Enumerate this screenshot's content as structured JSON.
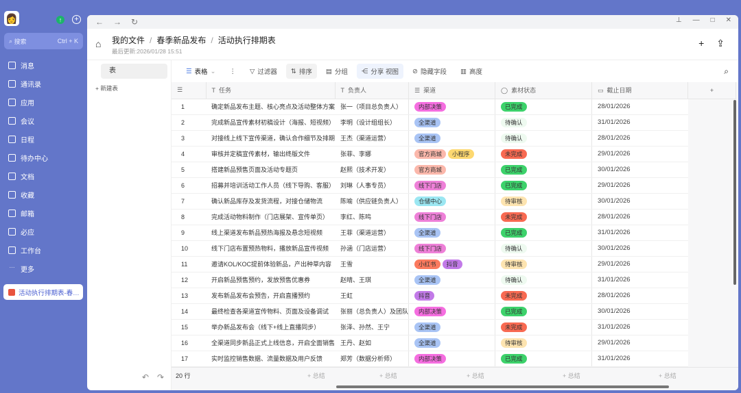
{
  "sidebar": {
    "search_placeholder": "搜索",
    "search_shortcut": "Ctrl + K",
    "items": [
      {
        "label": "消息",
        "icon": "message-icon"
      },
      {
        "label": "通讯录",
        "icon": "contacts-icon"
      },
      {
        "label": "应用",
        "icon": "apps-icon"
      },
      {
        "label": "会议",
        "icon": "meeting-icon"
      },
      {
        "label": "日程",
        "icon": "calendar-icon"
      },
      {
        "label": "待办中心",
        "icon": "todo-icon"
      },
      {
        "label": "文档",
        "icon": "docs-icon"
      },
      {
        "label": "收藏",
        "icon": "favorites-icon"
      },
      {
        "label": "邮箱",
        "icon": "mail-icon"
      },
      {
        "label": "必应",
        "icon": "bolt-icon"
      },
      {
        "label": "工作台",
        "icon": "workbench-icon"
      },
      {
        "label": "更多",
        "icon": "more-icon"
      }
    ],
    "recent": "活动执行排期表-春季新品发布"
  },
  "header": {
    "breadcrumb": [
      "我的文件",
      "春季新品发布",
      "活动执行排期表"
    ],
    "last_updated": "最后更新:2026/01/28 15:51"
  },
  "left_panel": {
    "table_name": "表",
    "new_table": "+ 新建表"
  },
  "toolbar": {
    "view": "表格",
    "filter": "过滤器",
    "sort": "排序",
    "group": "分组",
    "share": "分享 视图",
    "hide": "隐藏字段",
    "height": "高度"
  },
  "columns": [
    "任务",
    "负责人",
    "渠道",
    "素材状态",
    "截止日期"
  ],
  "tag_colors": {
    "内部决策": "#f56ee0",
    "全渠道": "#a9c4f5",
    "官方商城": "#fbb8ab",
    "小程序": "#fdd870",
    "线下门店": "#ee80d8",
    "仓储中心": "#9be7f2",
    "小红书": "#fb7a5e",
    "抖音": "#c27ae8",
    "已完成": "#3dd26b",
    "待确认": "#eefaf0",
    "未完成": "#f86a52",
    "待审核": "#fde4b0"
  },
  "rows": [
    {
      "n": "1",
      "task": "确定新品发布主题、核心亮点及活动整体方案",
      "owner": "张一（项目总负责人）",
      "channels": [
        "内部决策"
      ],
      "status": "已完成",
      "date": "28/01/2026"
    },
    {
      "n": "2",
      "task": "完成新品宣传素材初稿设计（海报、短视频）",
      "owner": "李明（设计组组长）",
      "channels": [
        "全渠道"
      ],
      "status": "待确认",
      "date": "31/01/2026"
    },
    {
      "n": "3",
      "task": "对接线上线下宣传渠道，确认合作细节及排期",
      "owner": "王杰（渠道运营）",
      "channels": [
        "全渠道"
      ],
      "status": "待确认",
      "date": "28/01/2026"
    },
    {
      "n": "4",
      "task": "审核并定稿宣传素材，输出终版文件",
      "owner": "张菲、李娜",
      "channels": [
        "官方商城",
        "小程序"
      ],
      "status": "未完成",
      "date": "29/01/2026"
    },
    {
      "n": "5",
      "task": "搭建新品预售页面及活动专题页",
      "owner": "赵熙（技术开发）",
      "channels": [
        "官方商城"
      ],
      "status": "已完成",
      "date": "30/01/2026"
    },
    {
      "n": "6",
      "task": "招募并培训活动工作人员（线下导购、客服）",
      "owner": "刘琳（人事专员）",
      "channels": [
        "线下门店"
      ],
      "status": "已完成",
      "date": "29/01/2026"
    },
    {
      "n": "7",
      "task": "确认新品库存及发货流程，对接仓储物流",
      "owner": "陈喻（供应链负责人）",
      "channels": [
        "仓储中心"
      ],
      "status": "待审核",
      "date": "30/01/2026"
    },
    {
      "n": "8",
      "task": "完成活动物料制作（门店展架、宣传单页）",
      "owner": "李红、陈鸣",
      "channels": [
        "线下门店"
      ],
      "status": "未完成",
      "date": "28/01/2026"
    },
    {
      "n": "9",
      "task": "线上渠道发布新品预热海报及悬念短视频",
      "owner": "王菲（渠道运营）",
      "channels": [
        "全渠道"
      ],
      "status": "已完成",
      "date": "31/01/2026"
    },
    {
      "n": "10",
      "task": "线下门店布置预热物料，播放新品宣传视频",
      "owner": "孙涵（门店运营）",
      "channels": [
        "线下门店"
      ],
      "status": "待确认",
      "date": "30/01/2026"
    },
    {
      "n": "11",
      "task": "邀请KOL/KOC提前体验新品，产出种草内容",
      "owner": "王雪",
      "channels": [
        "小红书",
        "抖音"
      ],
      "status": "待审核",
      "date": "29/01/2026"
    },
    {
      "n": "12",
      "task": "开启新品预售预约，发放预售优惠券",
      "owner": "赵晴、王琪",
      "channels": [
        "全渠道"
      ],
      "status": "待确认",
      "date": "31/01/2026"
    },
    {
      "n": "13",
      "task": "发布新品发布会预告，开启直播预约",
      "owner": "王虹",
      "channels": [
        "抖音"
      ],
      "status": "未完成",
      "date": "28/01/2026"
    },
    {
      "n": "14",
      "task": "最终检查各渠道宣传物料、页面及设备调试",
      "owner": "张丽（总负责人）及团队",
      "channels": [
        "内部决策"
      ],
      "status": "已完成",
      "date": "30/01/2026"
    },
    {
      "n": "15",
      "task": "举办新品发布会（线下+线上直播同步）",
      "owner": "张泽、孙然、王宁",
      "channels": [
        "全渠道"
      ],
      "status": "未完成",
      "date": "31/01/2026"
    },
    {
      "n": "16",
      "task": "全渠道同步新品正式上线信息，开启全面销售",
      "owner": "王丹、赵如",
      "channels": [
        "全渠道"
      ],
      "status": "待审核",
      "date": "29/01/2026"
    },
    {
      "n": "17",
      "task": "实时监控销售数据、流量数据及用户反馈",
      "owner": "郑芳（数据分析师）",
      "channels": [
        "内部决策"
      ],
      "status": "已完成",
      "date": "31/01/2026"
    }
  ],
  "footer": {
    "row_count": "20 行",
    "summary": "总结"
  }
}
